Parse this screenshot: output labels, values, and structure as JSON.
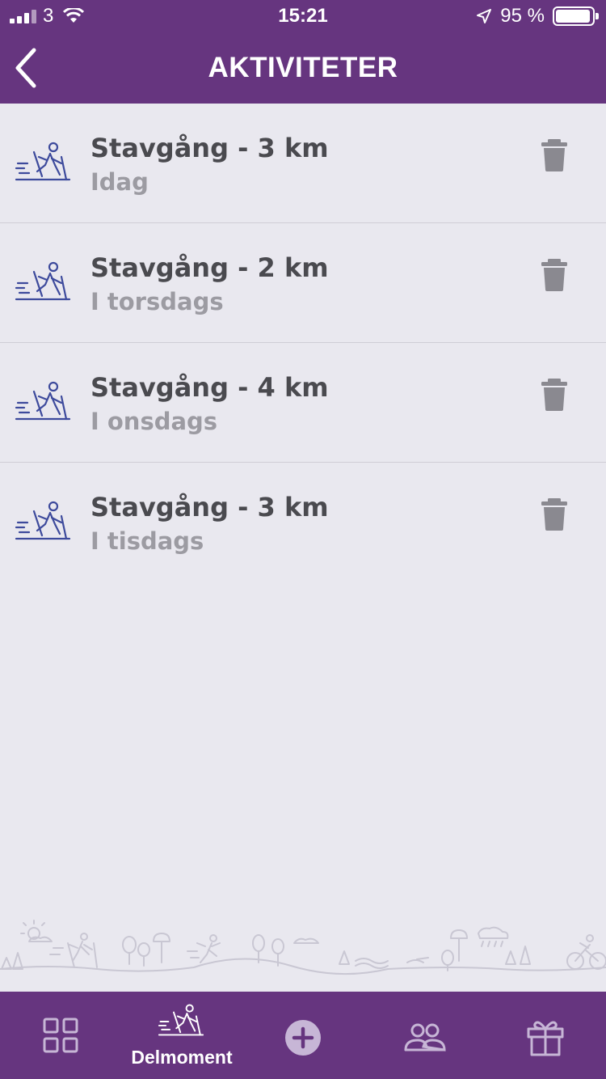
{
  "status_bar": {
    "carrier": "3",
    "time": "15:21",
    "battery": "95 %",
    "battery_level": 0.95
  },
  "header": {
    "title": "AKTIVITETER"
  },
  "activities": [
    {
      "title": "Stavgång - 3 km",
      "subtitle": "Idag",
      "icon": "nordic-walking-icon"
    },
    {
      "title": "Stavgång - 2 km",
      "subtitle": "I torsdags",
      "icon": "nordic-walking-icon"
    },
    {
      "title": "Stavgång - 4 km",
      "subtitle": "I onsdags",
      "icon": "nordic-walking-icon"
    },
    {
      "title": "Stavgång - 3 km",
      "subtitle": "I tisdags",
      "icon": "nordic-walking-icon"
    }
  ],
  "tabbar": {
    "tabs": [
      {
        "icon": "grid-icon",
        "label": ""
      },
      {
        "icon": "nordic-walking-icon",
        "label": "Delmoment",
        "active": true
      },
      {
        "icon": "add-circle-icon",
        "label": ""
      },
      {
        "icon": "people-icon",
        "label": ""
      },
      {
        "icon": "gift-icon",
        "label": ""
      }
    ]
  },
  "colors": {
    "brand_purple": "#66357f",
    "background": "#e9e8ef",
    "icon_blue": "#3d4a9c",
    "trash_gray": "#8a8990"
  }
}
